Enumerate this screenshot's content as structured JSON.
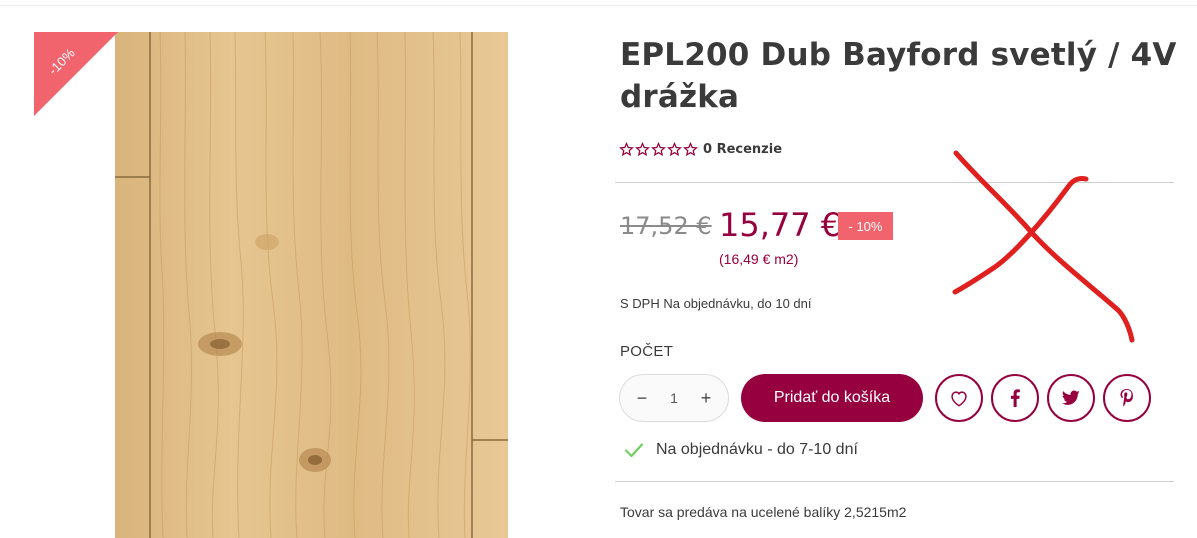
{
  "product": {
    "title_line1": "EPL200 Dub Bayford svetlý / 4V",
    "title_line2": "drážka",
    "rating": {
      "stars": 0,
      "max": 5,
      "reviews_label": "0 Recenzie"
    },
    "image_discount_label": "-10%"
  },
  "pricing": {
    "old_price": "17,52 €",
    "new_price": "15,77 €",
    "discount_badge": "- 10%",
    "unit_price": "(16,49 € m2)",
    "availability_note": "S DPH Na objednávku, do 10 dní"
  },
  "quantity": {
    "label": "POČET",
    "value": "1",
    "minus_symbol": "−",
    "plus_symbol": "+"
  },
  "actions": {
    "add_to_cart_label": "Pridať do košíka",
    "wishlist_icon": "heart-icon",
    "facebook_icon": "facebook-icon",
    "twitter_icon": "twitter-icon",
    "pinterest_icon": "pinterest-icon"
  },
  "stock": {
    "label": "Na objednávku - do 7-10 dní",
    "icon": "check-icon"
  },
  "package_note": "Tovar sa predáva na ucelené balíky 2,5215m2",
  "colors": {
    "brand": "#96003e",
    "discount": "#f1646e",
    "check": "#6fcf5f",
    "annotation_cross": "#e0201f"
  }
}
